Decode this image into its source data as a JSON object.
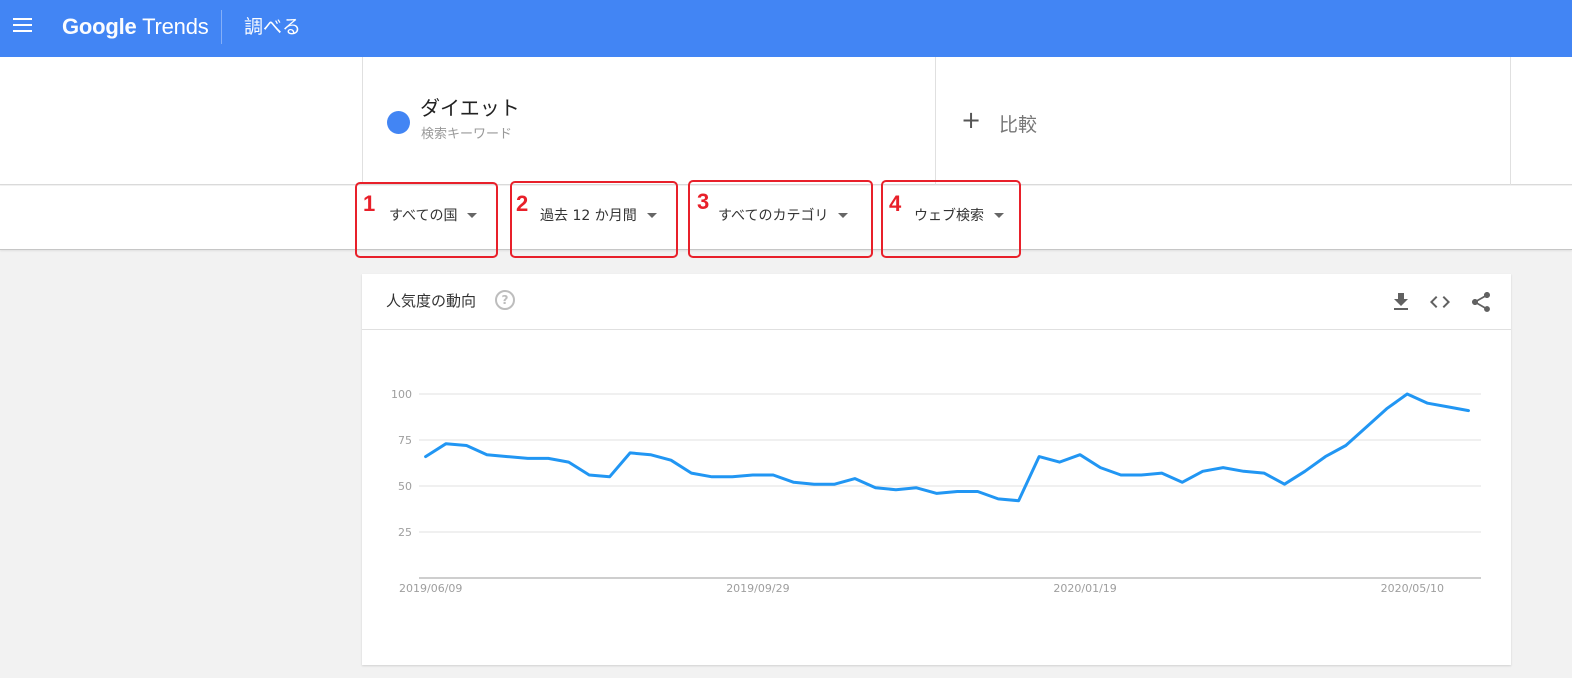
{
  "header": {
    "logo_google": "Google",
    "logo_trends": "Trends",
    "section_title": "調べる"
  },
  "term": {
    "name": "ダイエット",
    "subtitle": "検索キーワード",
    "color": "#4285f4"
  },
  "compare": {
    "plus": "+",
    "label": "比較"
  },
  "filters": [
    {
      "label": "すべての国",
      "number": "1"
    },
    {
      "label": "過去 12 か月間",
      "number": "2"
    },
    {
      "label": "すべてのカテゴリ",
      "number": "3"
    },
    {
      "label": "ウェブ検索",
      "number": "4"
    }
  ],
  "highlight_color": "#e8202a",
  "chart_card": {
    "title": "人気度の動向",
    "help": "?",
    "icons": [
      "download-icon",
      "embed-icon",
      "share-icon"
    ]
  },
  "chart_data": {
    "type": "line",
    "series": [
      {
        "color": "#2196f3",
        "values": [
          66,
          73,
          72,
          67,
          66,
          65,
          65,
          63,
          56,
          55,
          68,
          67,
          64,
          57,
          55,
          55,
          56,
          56,
          52,
          51,
          51,
          54,
          49,
          48,
          49,
          46,
          47,
          47,
          43,
          42,
          66,
          63,
          67,
          60,
          56,
          56,
          57,
          52,
          58,
          60,
          58,
          57,
          51,
          58,
          66,
          72,
          82,
          92,
          100,
          95,
          93,
          91
        ]
      }
    ],
    "x_tick_labels": [
      "2019/06/09",
      "2019/09/29",
      "2020/01/19",
      "2020/05/10"
    ],
    "x_tick_indices": [
      0,
      16,
      32,
      48
    ],
    "y_ticks": [
      25,
      50,
      75,
      100
    ],
    "ylim": [
      0,
      100
    ],
    "grid": true
  }
}
